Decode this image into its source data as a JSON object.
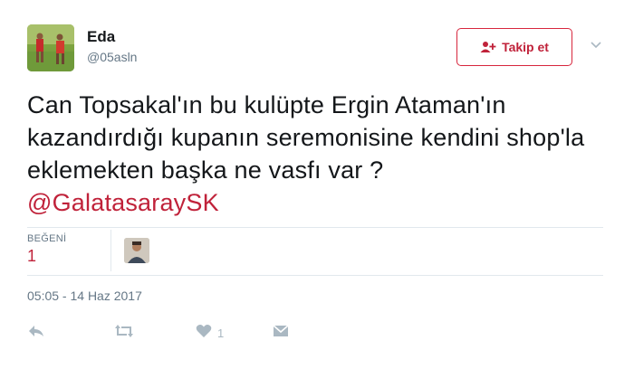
{
  "user": {
    "display_name": "Eda",
    "handle": "@05asln"
  },
  "follow_button": {
    "label": "Takip et",
    "icon": "add-user-icon"
  },
  "tweet": {
    "text": "Can Topsakal'ın bu kulüpte Ergin Ataman'ın kazandırdığı kupanın seremonisine kendini shop'la eklemekten başka ne vasfı var ?",
    "mention": "@GalatasaraySK"
  },
  "stats": {
    "likes_label": "BEĞENİ",
    "likes_count": "1"
  },
  "timestamp": "05:05 - 14 Haz 2017",
  "actions": {
    "reply_icon": "reply-icon",
    "retweet_icon": "retweet-icon",
    "like_icon": "heart-icon",
    "like_count": "1",
    "dm_icon": "envelope-icon"
  },
  "colors": {
    "accent": "#c0223a",
    "muted": "#657786",
    "icon": "#aab8c2",
    "divider": "#e1e8ed"
  }
}
